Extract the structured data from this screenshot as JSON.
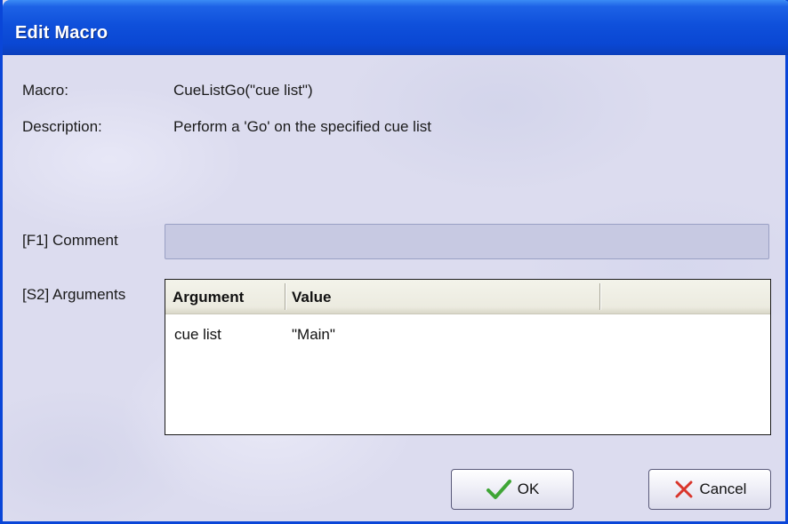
{
  "window": {
    "title": "Edit Macro"
  },
  "macro": {
    "label": "Macro:",
    "value": "CueListGo(\"cue list\")",
    "description_label": "Description:",
    "description": "Perform a 'Go' on the specified cue list"
  },
  "comment": {
    "label": "[F1] Comment",
    "value": ""
  },
  "arguments": {
    "label": "[S2] Arguments",
    "columns": [
      "Argument",
      "Value"
    ],
    "rows": [
      {
        "argument": "cue list",
        "value": "\"Main\""
      }
    ]
  },
  "buttons": {
    "ok": "OK",
    "cancel": "Cancel"
  },
  "icons": {
    "ok": "checkmark-icon",
    "cancel": "x-mark-icon"
  },
  "colors": {
    "title_bar": "#0a47d3",
    "ok_check": "#3fa536",
    "cancel_x": "#d9352b"
  }
}
